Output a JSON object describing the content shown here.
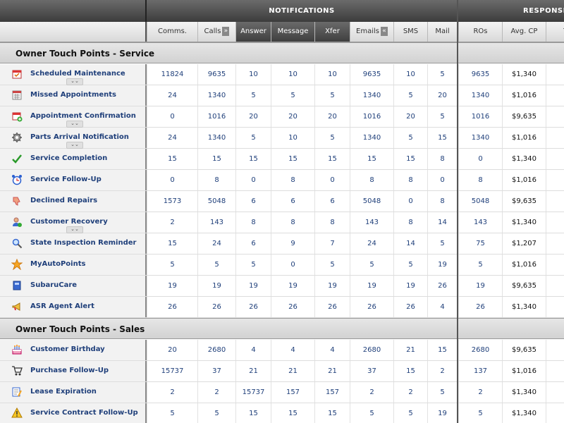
{
  "header": {
    "notifications_label": "NOTIFICATIONS",
    "responses_label": "RESPONSE"
  },
  "columns": [
    {
      "label": "Comms.",
      "dark": false,
      "arrow": ""
    },
    {
      "label": "Calls",
      "dark": false,
      "arrow": "»"
    },
    {
      "label": "Answer",
      "dark": true,
      "arrow": ""
    },
    {
      "label": "Message",
      "dark": true,
      "arrow": ""
    },
    {
      "label": "Xfer",
      "dark": true,
      "arrow": ""
    },
    {
      "label": "Emails",
      "dark": false,
      "arrow": "«"
    },
    {
      "label": "SMS",
      "dark": false,
      "arrow": ""
    },
    {
      "label": "Mail",
      "dark": false,
      "arrow": ""
    },
    {
      "label": "ROs",
      "dark": false,
      "arrow": ""
    },
    {
      "label": "Avg. CP",
      "dark": false,
      "arrow": ""
    },
    {
      "label": "Te",
      "dark": false,
      "arrow": ""
    }
  ],
  "sections": [
    {
      "title": "Owner Touch Points - Service",
      "rows": [
        {
          "name": "Scheduled Maintenance",
          "icon": "calendar-icon",
          "expand": true,
          "values": [
            "11824",
            "9635",
            "10",
            "10",
            "10",
            "9635",
            "10",
            "5",
            "9635",
            "$1,340",
            "$"
          ]
        },
        {
          "name": "Missed Appointments",
          "icon": "calendar-grid-icon",
          "expand": false,
          "values": [
            "24",
            "1340",
            "5",
            "5",
            "5",
            "1340",
            "5",
            "20",
            "1340",
            "$1,016",
            "$"
          ]
        },
        {
          "name": "Appointment Confirmation",
          "icon": "calendar-add-icon",
          "expand": true,
          "values": [
            "0",
            "1016",
            "20",
            "20",
            "20",
            "1016",
            "20",
            "5",
            "1016",
            "$9,635",
            "$"
          ]
        },
        {
          "name": "Parts Arrival Notification",
          "icon": "gear-icon",
          "expand": true,
          "values": [
            "24",
            "1340",
            "5",
            "10",
            "5",
            "1340",
            "5",
            "15",
            "1340",
            "$1,016",
            "$"
          ]
        },
        {
          "name": "Service Completion",
          "icon": "checkmark-icon",
          "expand": false,
          "values": [
            "15",
            "15",
            "15",
            "15",
            "15",
            "15",
            "15",
            "8",
            "0",
            "$1,340",
            "$"
          ]
        },
        {
          "name": "Service Follow-Up",
          "icon": "alarm-clock-icon",
          "expand": false,
          "values": [
            "0",
            "8",
            "0",
            "8",
            "0",
            "8",
            "8",
            "0",
            "8",
            "$1,016",
            "$"
          ]
        },
        {
          "name": "Declined Repairs",
          "icon": "thumbs-down-icon",
          "expand": false,
          "values": [
            "1573",
            "5048",
            "6",
            "6",
            "6",
            "5048",
            "0",
            "8",
            "5048",
            "$9,635",
            "$"
          ]
        },
        {
          "name": "Customer Recovery",
          "icon": "user-recovery-icon",
          "expand": true,
          "values": [
            "2",
            "143",
            "8",
            "8",
            "8",
            "143",
            "8",
            "14",
            "143",
            "$1,340",
            "$"
          ]
        },
        {
          "name": "State Inspection Reminder",
          "icon": "magnifier-icon",
          "expand": false,
          "values": [
            "15",
            "24",
            "6",
            "9",
            "7",
            "24",
            "14",
            "5",
            "75",
            "$1,207",
            "$"
          ]
        },
        {
          "name": "MyAutoPoints",
          "icon": "star-icon",
          "expand": false,
          "values": [
            "5",
            "5",
            "5",
            "0",
            "5",
            "5",
            "5",
            "19",
            "5",
            "$1,016",
            "$"
          ]
        },
        {
          "name": "SubaruCare",
          "icon": "book-icon",
          "expand": false,
          "values": [
            "19",
            "19",
            "19",
            "19",
            "19",
            "19",
            "19",
            "26",
            "19",
            "$9,635",
            "$"
          ]
        },
        {
          "name": "ASR Agent Alert",
          "icon": "megaphone-icon",
          "expand": false,
          "values": [
            "26",
            "26",
            "26",
            "26",
            "26",
            "26",
            "26",
            "4",
            "26",
            "$1,340",
            "$"
          ]
        }
      ]
    },
    {
      "title": "Owner Touch Points - Sales",
      "rows": [
        {
          "name": "Customer Birthday",
          "icon": "birthday-cake-icon",
          "expand": false,
          "values": [
            "20",
            "2680",
            "4",
            "4",
            "4",
            "2680",
            "21",
            "15",
            "2680",
            "$9,635",
            "$"
          ]
        },
        {
          "name": "Purchase Follow-Up",
          "icon": "shopping-cart-icon",
          "expand": false,
          "values": [
            "15737",
            "37",
            "21",
            "21",
            "21",
            "37",
            "15",
            "2",
            "137",
            "$1,016",
            "$"
          ]
        },
        {
          "name": "Lease Expiration",
          "icon": "document-pen-icon",
          "expand": false,
          "values": [
            "2",
            "2",
            "15737",
            "157",
            "157",
            "2",
            "2",
            "5",
            "2",
            "$1,340",
            "$"
          ]
        },
        {
          "name": "Service Contract Follow-Up",
          "icon": "warning-icon",
          "expand": false,
          "values": [
            "5",
            "5",
            "15",
            "15",
            "15",
            "5",
            "5",
            "19",
            "5",
            "$1,340",
            "$"
          ]
        }
      ]
    }
  ],
  "colors": {
    "link": "#1f3f7a",
    "header_dark": "#4a4a4a",
    "section_bg": "#dcdcdc"
  }
}
